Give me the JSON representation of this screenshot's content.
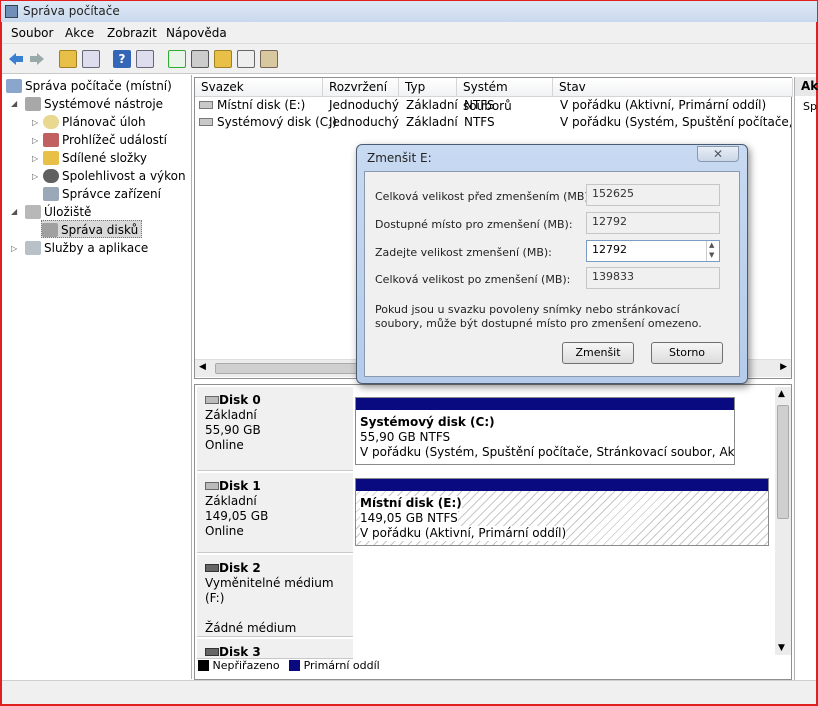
{
  "window": {
    "title": "Správa počítače"
  },
  "menu": [
    "Soubor",
    "Akce",
    "Zobrazit",
    "Nápověda"
  ],
  "tree": {
    "root": "Správa počítače (místní)",
    "system_tools": "Systémové nástroje",
    "task_scheduler": "Plánovač úloh",
    "event_viewer": "Prohlížeč událostí",
    "shared_folders": "Sdílené složky",
    "reliability": "Spolehlivost a výkon",
    "device_manager": "Správce zařízení",
    "storage": "Úložiště",
    "disk_management": "Správa disků",
    "services": "Služby a aplikace"
  },
  "volumes": {
    "headers": [
      "Svazek",
      "Rozvržení",
      "Typ",
      "Systém souborů",
      "Stav"
    ],
    "rows": [
      {
        "name": "Místní disk (E:)",
        "layout": "Jednoduchý",
        "type": "Základní",
        "fs": "NTFS",
        "status": "V pořádku (Aktivní, Primární oddíl)"
      },
      {
        "name": "Systémový disk (C:)",
        "layout": "Jednoduchý",
        "type": "Základní",
        "fs": "NTFS",
        "status": "V pořádku (Systém, Spuštění počítače, Stránkovací soubor, Aktivní, Stránkovací soubor, Primární oddíl)"
      }
    ]
  },
  "disks": {
    "disk0": {
      "name": "Disk 0",
      "type": "Základní",
      "size": "55,90 GB",
      "state": "Online",
      "part_title": "Systémový disk  (C:)",
      "part_size": "55,90 GB NTFS",
      "part_status": "V pořádku (Systém, Spuštění počítače, Stránkovací soubor, Aktivní, Stránkovací soubor, Primární oddíl)"
    },
    "disk1": {
      "name": "Disk 1",
      "type": "Základní",
      "size": "149,05 GB",
      "state": "Online",
      "part_title": "Místní disk  (E:)",
      "part_size": "149,05 GB NTFS",
      "part_status": "V pořádku (Aktivní, Primární oddíl)"
    },
    "disk2": {
      "name": "Disk 2",
      "type": "Vyměnitelné médium (F:)",
      "state": "Žádné médium"
    },
    "disk3": {
      "name": "Disk 3"
    }
  },
  "legend": {
    "unallocated": "Nepřiřazeno",
    "primary": "Primární oddíl"
  },
  "action_pane": {
    "header": "Ak",
    "item": "Sp"
  },
  "dialog": {
    "title": "Zmenšit E:",
    "close": "✕",
    "total_before_label": "Celková velikost před zmenšením (MB):",
    "total_before_value": "152625",
    "available_label": "Dostupné místo pro zmenšení (MB):",
    "available_value": "12792",
    "enter_label": "Zadejte velikost zmenšení (MB):",
    "enter_value": "12792",
    "total_after_label": "Celková velikost po zmenšení (MB):",
    "total_after_value": "139833",
    "note": "Pokud jsou u svazku povoleny snímky nebo stránkovací soubory, může být dostupné místo pro zmenšení omezeno.",
    "shrink_button": "Zmenšit",
    "cancel_button": "Storno"
  },
  "colors": {
    "primary_partition": "#0a0a80",
    "unallocated": "#000000",
    "accent": "#e02020"
  }
}
